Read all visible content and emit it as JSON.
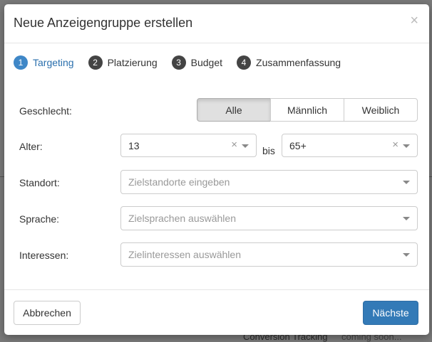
{
  "background": {
    "fragment_1": "Conversion Tracking",
    "fragment_2": "coming soon..."
  },
  "modal": {
    "title": "Neue Anzeigengruppe erstellen",
    "close_label": "×"
  },
  "steps": [
    {
      "number": "1",
      "label": "Targeting",
      "active": true
    },
    {
      "number": "2",
      "label": "Platzierung",
      "active": false
    },
    {
      "number": "3",
      "label": "Budget",
      "active": false
    },
    {
      "number": "4",
      "label": "Zusammenfassung",
      "active": false
    }
  ],
  "form": {
    "gender": {
      "label": "Geschlecht:",
      "options": [
        "Alle",
        "Männlich",
        "Weiblich"
      ],
      "selected": "Alle"
    },
    "age": {
      "label": "Alter:",
      "from": "13",
      "separator": "bis",
      "to": "65+",
      "clear_glyph": "×"
    },
    "location": {
      "label": "Standort:",
      "placeholder": "Zielstandorte eingeben"
    },
    "language": {
      "label": "Sprache:",
      "placeholder": "Zielsprachen auswählen"
    },
    "interests": {
      "label": "Interessen:",
      "placeholder": "Zielinteressen auswählen"
    }
  },
  "footer": {
    "cancel_label": "Abbrechen",
    "next_label": "Nächste"
  },
  "colors": {
    "primary": "#337ab7",
    "step_active": "#3f87c7",
    "step_inactive": "#444444"
  }
}
